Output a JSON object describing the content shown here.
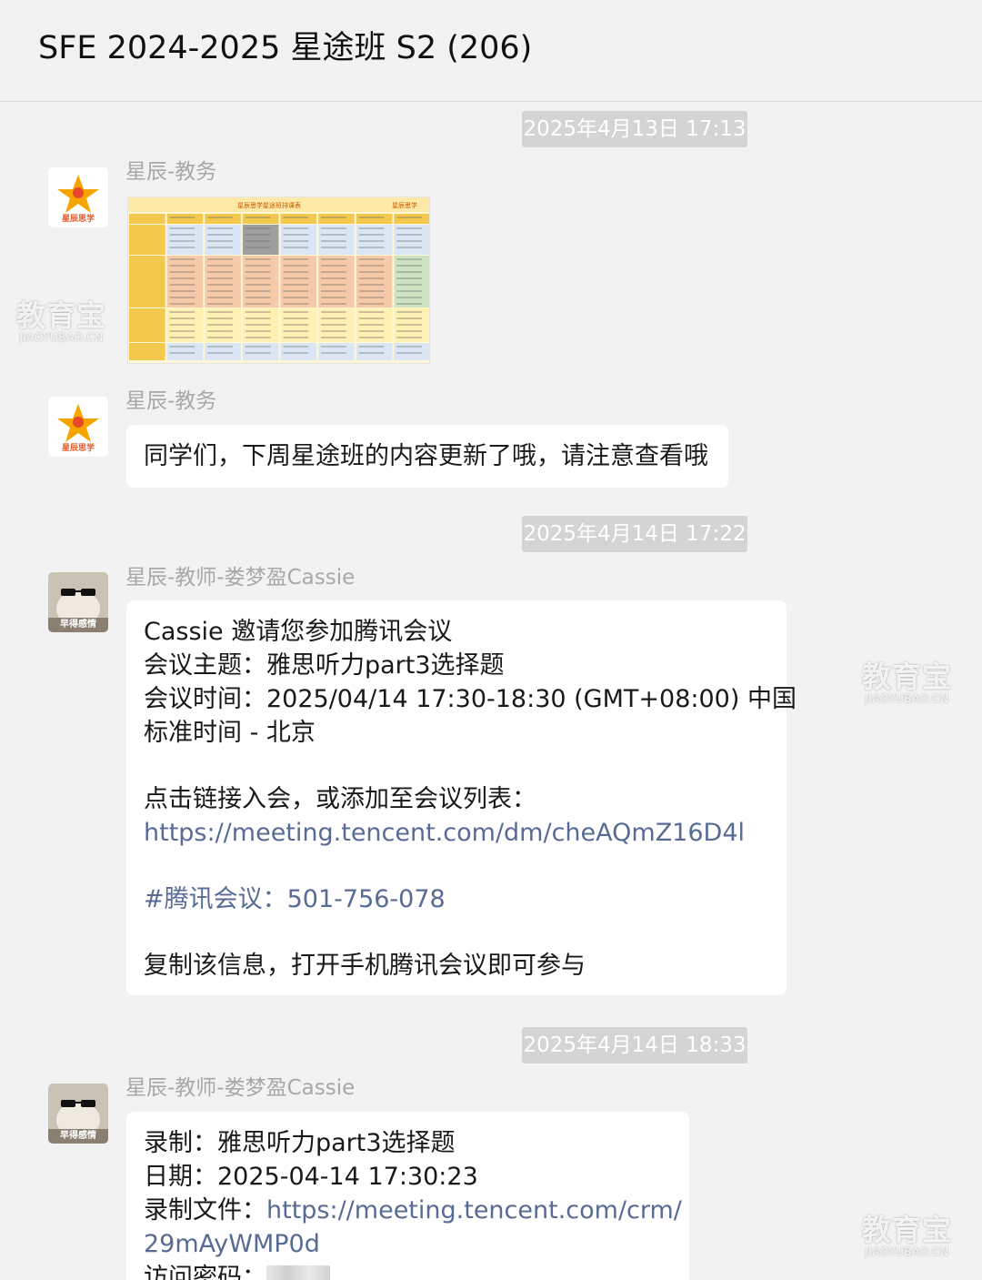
{
  "header": {
    "title": "SFE 2024-2025 星途班 S2 (206)"
  },
  "timestamps": [
    "2025年4月13日 17:13",
    "2025年4月14日 17:22",
    "2025年4月14日 18:33"
  ],
  "messages": [
    {
      "sender": "星辰-教务",
      "avatar_text": "星辰思学",
      "type": "image",
      "image": {
        "brand": "星辰思学",
        "title": "星辰思学星途班排课表",
        "colors": [
          "#dbe6f4",
          "#f6c9a8",
          "#fff0b3",
          "#cde3c1",
          "#f2c94c"
        ]
      }
    },
    {
      "sender": "星辰-教务",
      "avatar_text": "星辰思学",
      "type": "text",
      "lines": [
        "同学们，下周星途班的内容更新了哦，请注意查看哦"
      ]
    },
    {
      "sender": "星辰-教师-娄梦盈Cassie",
      "avatar_text": "早得感情",
      "type": "text",
      "lines": [
        "Cassie 邀请您参加腾讯会议",
        "会议主题：雅思听力part3选择题",
        "会议时间：2025/04/14 17:30-18:30 (GMT+08:00) 中国",
        "标准时间 - 北京"
      ],
      "join_text": "点击链接入会，或添加至会议列表：",
      "join_link": "https://meeting.tencent.com/dm/cheAQmZ16D4l",
      "meeting_id": "#腾讯会议：501-756-078",
      "footer": "复制该信息，打开手机腾讯会议即可参与"
    },
    {
      "sender": "星辰-教师-娄梦盈Cassie",
      "avatar_text": "早得感情",
      "type": "text",
      "line1": "录制：雅思听力part3选择题",
      "line2": "日期：2025-04-14 17:30:23",
      "file_label": "录制文件：",
      "file_link_a": "https://meeting.tencent.com/crm/",
      "file_link_b": "29mAyWMP0d",
      "password_label": "访问密码："
    }
  ],
  "watermark": {
    "cn": "教育宝",
    "en": "JIAOYUBAO.CN"
  },
  "colors": {
    "link": "#576b95",
    "background": "#f2f2f2",
    "timestamp_bg": "#d4d4d4"
  }
}
